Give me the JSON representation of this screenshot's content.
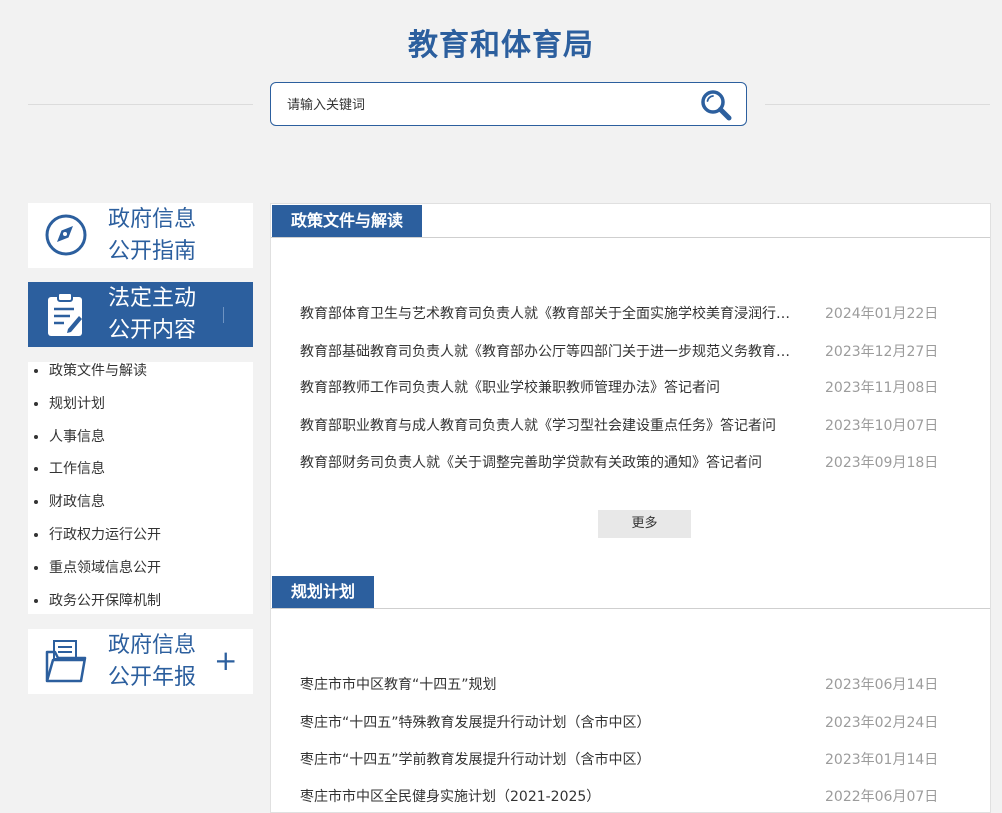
{
  "header": {
    "title": "教育和体育局"
  },
  "search": {
    "placeholder": "请输入关键词"
  },
  "sidebar": {
    "guide": {
      "title_line1": "政府信息",
      "title_line2": "公开指南"
    },
    "content": {
      "title_line1": "法定主动",
      "title_line2": "公开内容"
    },
    "items": [
      {
        "label": "政策文件与解读"
      },
      {
        "label": "规划计划"
      },
      {
        "label": "人事信息"
      },
      {
        "label": "工作信息"
      },
      {
        "label": "财政信息"
      },
      {
        "label": "行政权力运行公开"
      },
      {
        "label": "重点领域信息公开"
      },
      {
        "label": "政务公开保障机制"
      }
    ],
    "annual": {
      "title_line1": "政府信息",
      "title_line2": "公开年报",
      "expand_symbol": "+"
    }
  },
  "sections": [
    {
      "title": "政策文件与解读",
      "items": [
        {
          "title": "教育部体育卫生与艺术教育司负责人就《教育部关于全面实施学校美育浸润行动的通知》答记者问",
          "date": "2024年01月22日"
        },
        {
          "title": "教育部基础教育司负责人就《教育部办公厅等四部门关于进一步规范义务教育课后服务有关工作的通知》答记者问",
          "date": "2023年12月27日"
        },
        {
          "title": "教育部教师工作司负责人就《职业学校兼职教师管理办法》答记者问",
          "date": "2023年11月08日"
        },
        {
          "title": "教育部职业教育与成人教育司负责人就《学习型社会建设重点任务》答记者问",
          "date": "2023年10月07日"
        },
        {
          "title": "教育部财务司负责人就《关于调整完善助学贷款有关政策的通知》答记者问",
          "date": "2023年09月18日"
        }
      ],
      "more_label": "更多"
    },
    {
      "title": "规划计划",
      "items": [
        {
          "title": "枣庄市市中区教育“十四五”规划",
          "date": "2023年06月14日"
        },
        {
          "title": "枣庄市“十四五”特殊教育发展提升行动计划（含市中区）",
          "date": "2023年02月24日"
        },
        {
          "title": "枣庄市“十四五”学前教育发展提升行动计划（含市中区）",
          "date": "2023年01月14日"
        },
        {
          "title": "枣庄市市中区全民健身实施计划（2021-2025）",
          "date": "2022年06月07日"
        }
      ]
    }
  ],
  "colors": {
    "accent": "#2c5f9e",
    "background": "#f2f2f2",
    "date": "#9c9c9c"
  },
  "icons": {
    "search": "magnifier-icon",
    "guide": "compass-icon",
    "content": "clipboard-icon",
    "annual": "folder-icon"
  }
}
